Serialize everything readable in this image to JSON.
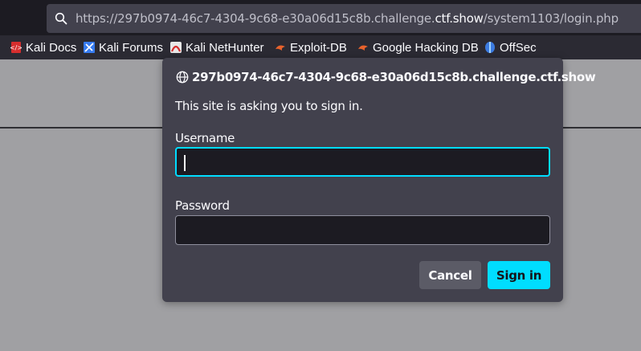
{
  "browser": {
    "url_prefix": "https://297b0974-46c7-4304-9c68-e30a06d15c8b.challenge.",
    "url_host": "ctf.show",
    "url_path": "/system1103/login.php"
  },
  "bookmarks": [
    {
      "label": "Kali Docs",
      "icon": "kali-docs-icon"
    },
    {
      "label": "Kali Forums",
      "icon": "kali-forums-icon"
    },
    {
      "label": "Kali NetHunter",
      "icon": "kali-nethunter-icon"
    },
    {
      "label": "Exploit-DB",
      "icon": "exploit-db-icon"
    },
    {
      "label": "Google Hacking DB",
      "icon": "google-hacking-db-icon"
    },
    {
      "label": "OffSec",
      "icon": "offsec-icon"
    }
  ],
  "dialog": {
    "origin": "297b0974-46c7-4304-9c68-e30a06d15c8b.challenge.ctf.show",
    "message": "This site is asking you to sign in.",
    "username_label": "Username",
    "username_value": "",
    "password_label": "Password",
    "password_value": "",
    "cancel_label": "Cancel",
    "signin_label": "Sign in"
  },
  "colors": {
    "accent": "#00ddff",
    "dialog_bg": "#42414d",
    "toolbar_bg": "#2b2a33",
    "page_bg": "#a0a0a3"
  }
}
